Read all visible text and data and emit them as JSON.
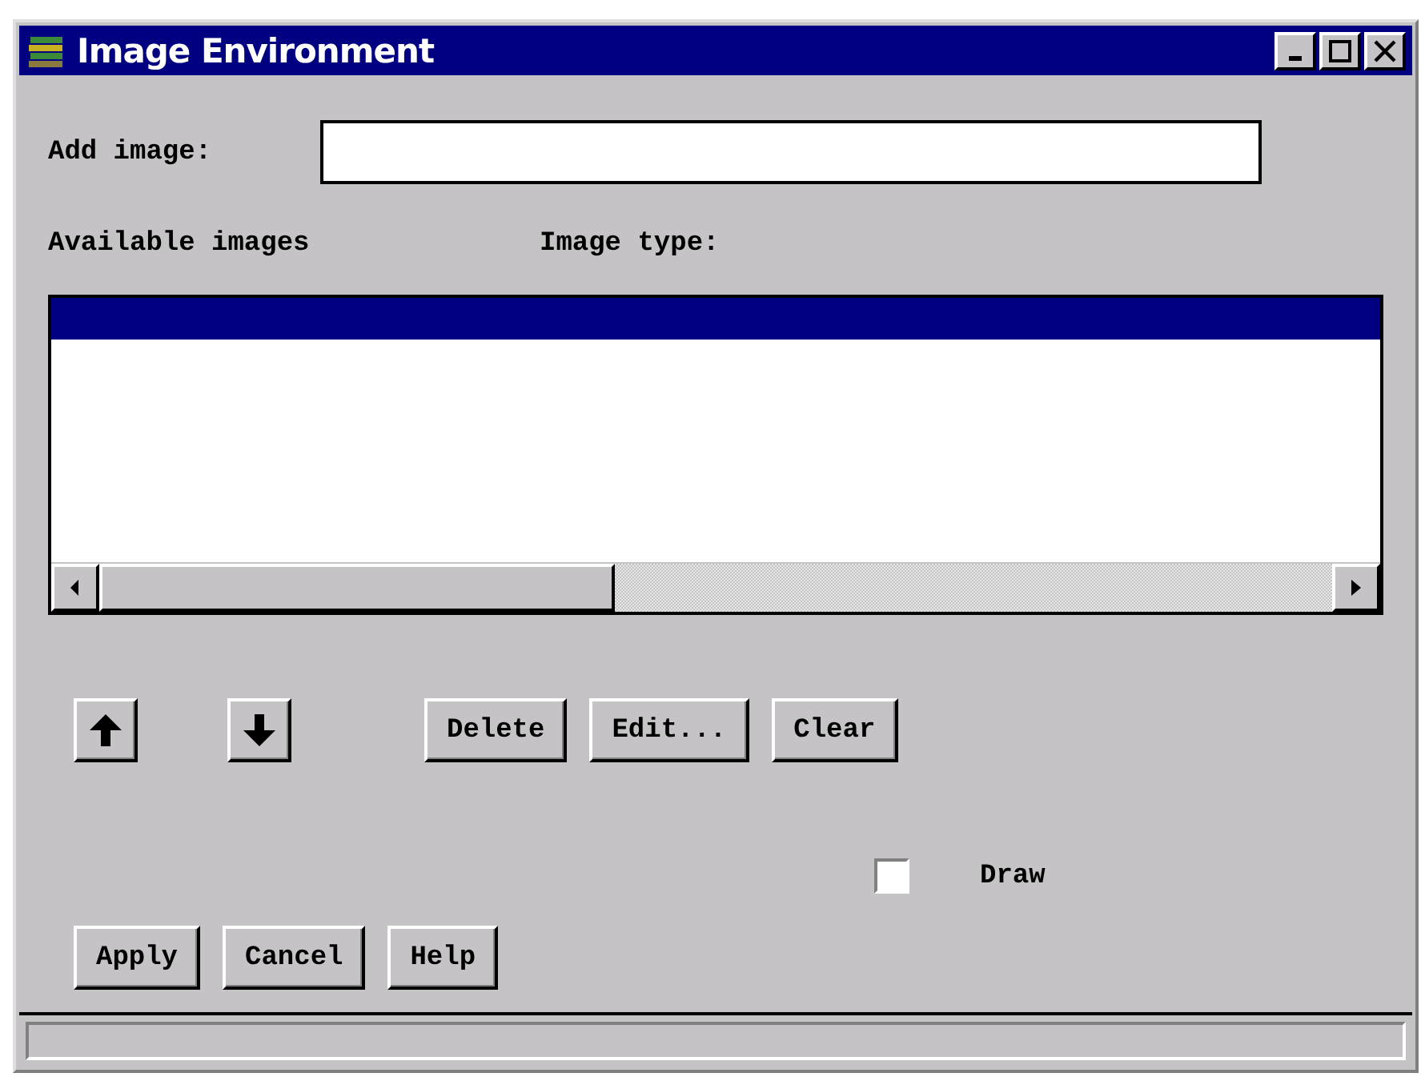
{
  "window": {
    "title": "Image Environment"
  },
  "add_image": {
    "label": "Add image:"
  },
  "list": {
    "headers": [
      "Available images",
      "Image type:"
    ],
    "rows": [
      {
        "selected": true
      }
    ]
  },
  "action_buttons": [
    "Delete",
    "Edit...",
    "Clear"
  ],
  "draw": {
    "label": "Draw",
    "checked": false
  },
  "buttons": [
    "Apply",
    "Cancel",
    "Help"
  ]
}
